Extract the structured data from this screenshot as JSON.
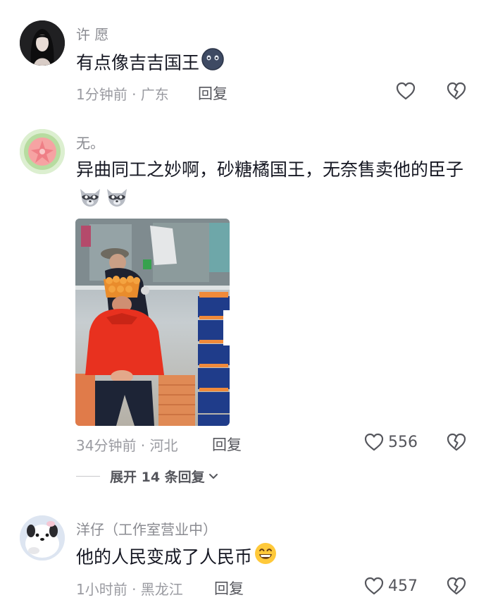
{
  "comments": [
    {
      "username": "许 愿",
      "text": "有点像吉吉国王",
      "time_location": "1分钟前 · 广东",
      "reply_label": "回复",
      "like_count": "",
      "avatar_icon": "dark-hair-girl-avatar",
      "emoji_icons": [
        "blob-face-emoji"
      ]
    },
    {
      "username": "无。",
      "text": "异曲同工之妙啊，砂糖橘国王，无奈售卖他的臣子",
      "time_location": "34分钟前 · 河北",
      "reply_label": "回复",
      "like_count": "556",
      "avatar_icon": "guava-fruit-avatar",
      "emoji_icons": [
        "raccoon-emoji",
        "raccoon-emoji"
      ],
      "image_icon": "orange-vendor-photo"
    },
    {
      "username": "洋仔（工作室营业中）",
      "text": "他的人民变成了人民币",
      "time_location": "1小时前 · 黑龙江",
      "reply_label": "回复",
      "like_count": "457",
      "avatar_icon": "cartoon-dog-avatar",
      "emoji_icons": [
        "grin-emoji"
      ]
    }
  ],
  "expand_replies": {
    "label": "展开 14 条回复"
  },
  "colors": {
    "text": "#161823",
    "secondary": "#8a8b91",
    "icon": "#55565c"
  }
}
